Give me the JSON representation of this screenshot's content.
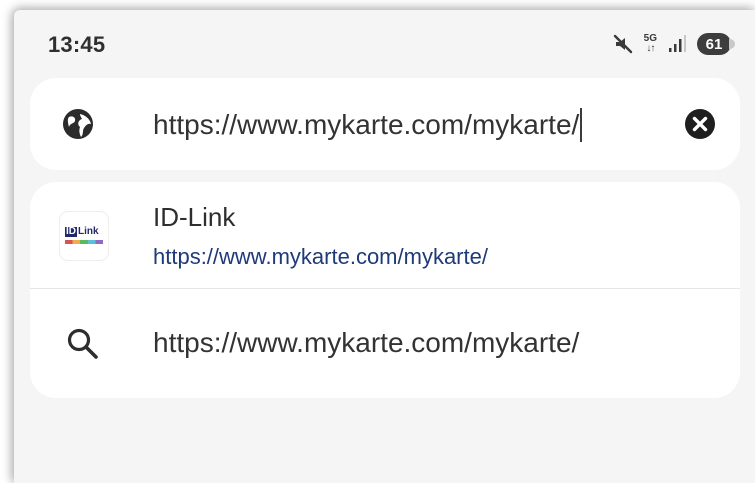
{
  "status_bar": {
    "time": "13:45",
    "network_top": "5G",
    "network_arrows": "↓↑",
    "battery": "61",
    "icons": [
      "mute-icon",
      "network-5g-icon",
      "signal-bars-icon",
      "battery-icon"
    ]
  },
  "address_bar": {
    "value": "https://www.mykarte.com/mykarte/",
    "icons": [
      "globe-icon",
      "clear-icon"
    ]
  },
  "suggestions": [
    {
      "type": "bookmark",
      "title": "ID-Link",
      "url": "https://www.mykarte.com/mykarte/",
      "favicon_text": "ID",
      "favicon_suffix": "Link"
    },
    {
      "type": "search",
      "query": "https://www.mykarte.com/mykarte/",
      "icon": "search-icon"
    }
  ],
  "colors": {
    "background": "#f5f5f5",
    "card": "#ffffff",
    "url_link": "#1f3a7a",
    "favicon_brand": "#1f2a6b"
  }
}
